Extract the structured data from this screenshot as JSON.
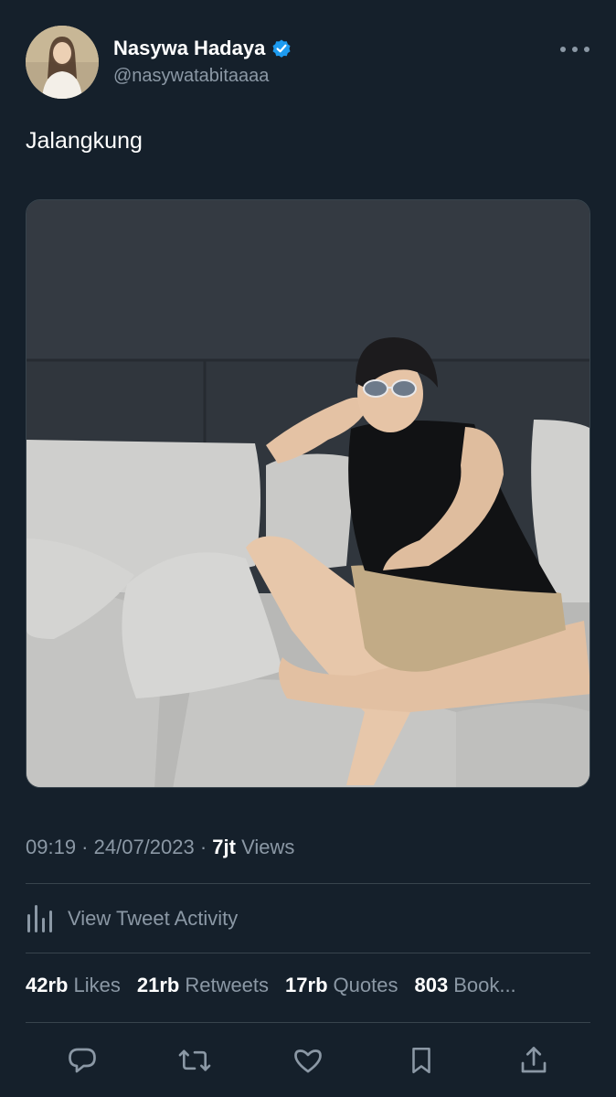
{
  "author": {
    "display_name": "Nasywa Hadaya",
    "handle": "@nasywatabitaaaa",
    "verified": true
  },
  "tweet": {
    "text": "Jalangkung"
  },
  "meta": {
    "time": "09:19",
    "separator1": " · ",
    "date": "24/07/2023",
    "separator2": " · ",
    "views_count": "7jt",
    "views_label": "Views"
  },
  "activity": {
    "label": "View Tweet Activity"
  },
  "stats": {
    "likes_count": "42rb",
    "likes_label": "Likes",
    "retweets_count": "21rb",
    "retweets_label": "Retweets",
    "quotes_count": "17rb",
    "quotes_label": "Quotes",
    "bookmarks_count": "803",
    "bookmarks_label": "Book..."
  },
  "icons": {
    "verified": "verified-badge-icon",
    "more": "more-icon",
    "activity": "bar-chart-icon",
    "reply": "reply-icon",
    "retweet": "retweet-icon",
    "like": "heart-icon",
    "bookmark": "bookmark-icon",
    "share": "share-icon"
  },
  "colors": {
    "background": "#15202b",
    "secondary_text": "#8b98a5",
    "divider": "#38444d",
    "verified_blue": "#1d9bf0"
  }
}
